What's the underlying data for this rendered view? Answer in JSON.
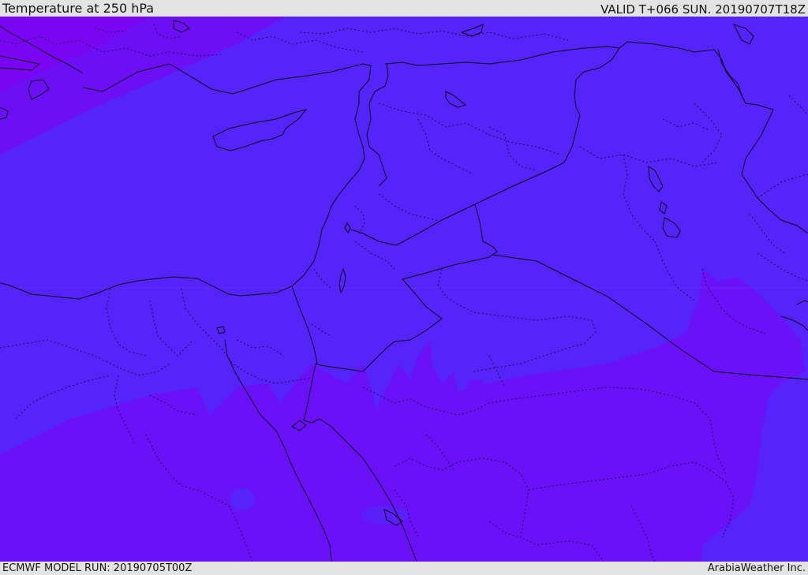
{
  "header": {
    "title": "Temperature at 250 hPa",
    "valid_time": "VALID T+066 SUN. 20190707T18Z"
  },
  "footer": {
    "model_run": "ECMWF MODEL RUN: 20190705T00Z",
    "credit": "ArabiaWeather Inc."
  },
  "map": {
    "field": "temperature",
    "level": "250 hPa",
    "colors": {
      "coldest": "#8000f4",
      "cold": "#6e0ff6",
      "base": "#5524fb",
      "warm_band": "#6c13f8",
      "border": "#000000"
    }
  }
}
